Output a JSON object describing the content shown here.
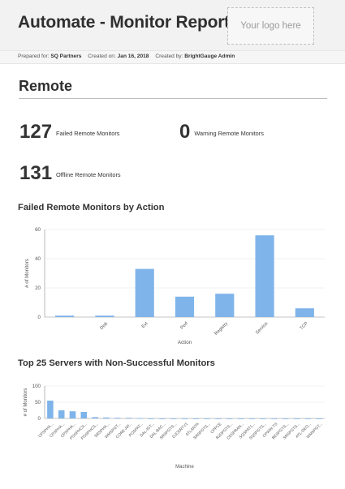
{
  "header": {
    "title": "Automate - Monitor Report",
    "logo_placeholder": "Your logo here"
  },
  "meta": {
    "prepared_for_label": "Prepared for:",
    "prepared_for": "SQ Partners",
    "created_on_label": "Created on:",
    "created_on": "Jan 16, 2018",
    "created_by_label": "Created by:",
    "created_by": "BrightGauge Admin"
  },
  "section": {
    "title": "Remote"
  },
  "stats": {
    "failed": {
      "value": "127",
      "label": "Failed Remote Monitors"
    },
    "warning": {
      "value": "0",
      "label": "Warning Remote Monitors"
    },
    "offline": {
      "value": "131",
      "label": "Offline Remote Monitors"
    }
  },
  "charts": {
    "colors": {
      "bar": "#7fb4ea",
      "axis": "#8a8a8a",
      "grid": "#e6e6e6",
      "text": "#555555"
    }
  },
  "chart_data": [
    {
      "type": "bar",
      "title": "Failed Remote Monitors by Action",
      "xlabel": "Action",
      "ylabel": "# of Monitors",
      "ylim": [
        0,
        60
      ],
      "yticks": [
        0,
        20,
        40,
        60
      ],
      "grid": true,
      "categories": [
        "",
        "Disk",
        "Evt",
        "Perf",
        "Registry",
        "Service",
        "TCP"
      ],
      "values": [
        1,
        1,
        33,
        14,
        16,
        56,
        6
      ]
    },
    {
      "type": "bar",
      "title": "Top 25 Servers with Non-Successful Monitors",
      "xlabel": "Machine",
      "ylabel": "# of Monitors",
      "ylim": [
        0,
        100
      ],
      "yticks": [
        0,
        50,
        100
      ],
      "grid": true,
      "categories": [
        "CPSPHA...",
        "CPSPHA...",
        "CPSPHA...",
        "POSPHCS...",
        "POSPHCS...",
        "SRSPHA...",
        "WMSPGT...",
        "CORE-AP...",
        "POSPAT...",
        "DAL-IGT...",
        "DAL-BAC...",
        "SRSPGTS...",
        "DJCERTV1",
        "ATLANTA",
        "SRSPGTS...",
        "CPPCE",
        "R2DPGTS...",
        "CESPRAN...",
        "SQSPAT1...",
        "SQSPGTS...",
        "CPWW-TS",
        "BESPGTS...",
        "SRSPGTS...",
        "ATL-DEO...",
        "WMSPGT..."
      ],
      "values": [
        55,
        25,
        22,
        20,
        4,
        3,
        2,
        2,
        1,
        0,
        0,
        0,
        0,
        0,
        0,
        0,
        0,
        0,
        0,
        0,
        0,
        0,
        0,
        0,
        0
      ]
    }
  ]
}
